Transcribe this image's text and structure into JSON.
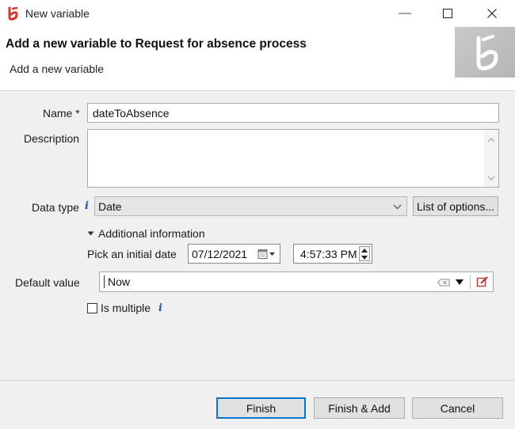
{
  "window": {
    "title": "New variable",
    "minimize_glyph": "—",
    "maximize_glyph": "☐",
    "close_glyph": "✕"
  },
  "header": {
    "title": "Add a new variable to Request for absence process",
    "subtitle": "Add a new variable"
  },
  "form": {
    "name_label": "Name *",
    "name_value": "dateToAbsence",
    "description_label": "Description",
    "description_value": "",
    "data_type_label": "Data type",
    "data_type_value": "Date",
    "list_of_options_label": "List of options...",
    "additional_info_label": "Additional information",
    "pick_initial_date_label": "Pick an initial date",
    "date_value": "07/12/2021",
    "time_value": "4:57:33 PM",
    "default_value_label": "Default value",
    "default_value": "Now",
    "is_multiple_label": "Is multiple",
    "is_multiple_checked": false
  },
  "footer": {
    "finish_label": "Finish",
    "finish_add_label": "Finish & Add",
    "cancel_label": "Cancel"
  },
  "colors": {
    "accent_blue": "#0078d7",
    "logo_red": "#d9362b",
    "info_blue": "#2a4fb0"
  },
  "icons": [
    "app-logo-icon",
    "minimize-icon",
    "maximize-icon",
    "close-icon",
    "info-icon",
    "chevron-down-icon",
    "calendar-icon",
    "spin-up-icon",
    "spin-down-icon",
    "clear-icon",
    "edit-icon"
  ]
}
